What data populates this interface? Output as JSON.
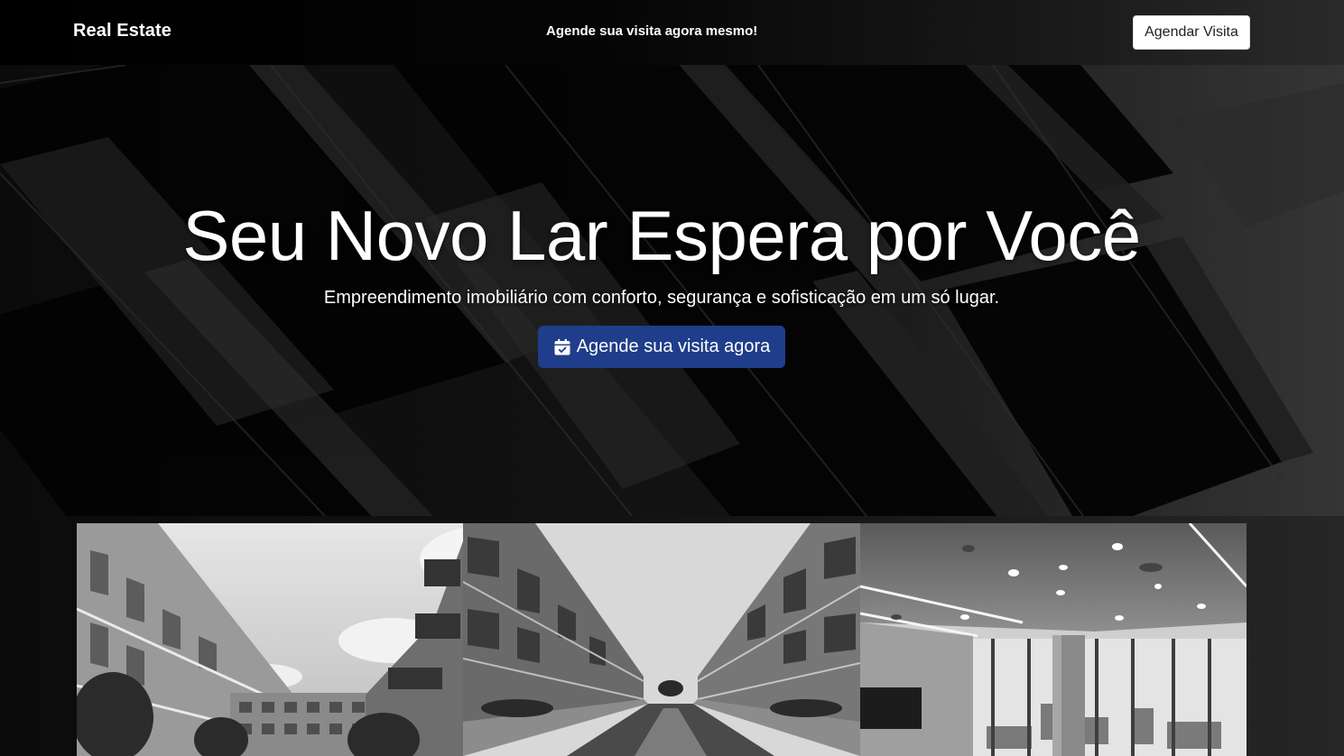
{
  "header": {
    "brand": "Real Estate",
    "tagline": "Agende sua visita agora mesmo!",
    "cta_label": "Agendar Visita"
  },
  "hero": {
    "title": "Seu Novo Lar Espera por Você",
    "subtitle": "Empreendimento imobiliário com conforto, segurança e sofisticação em um só lugar.",
    "cta_label": "Agende sua visita agora",
    "cta_icon": "calendar-check-icon",
    "cta_color": "#1f3d8a"
  },
  "gallery": {
    "photos": [
      {
        "subject": "courtyard-buildings-photo"
      },
      {
        "subject": "canal-between-buildings-photo"
      },
      {
        "subject": "office-interior-photo"
      }
    ]
  }
}
